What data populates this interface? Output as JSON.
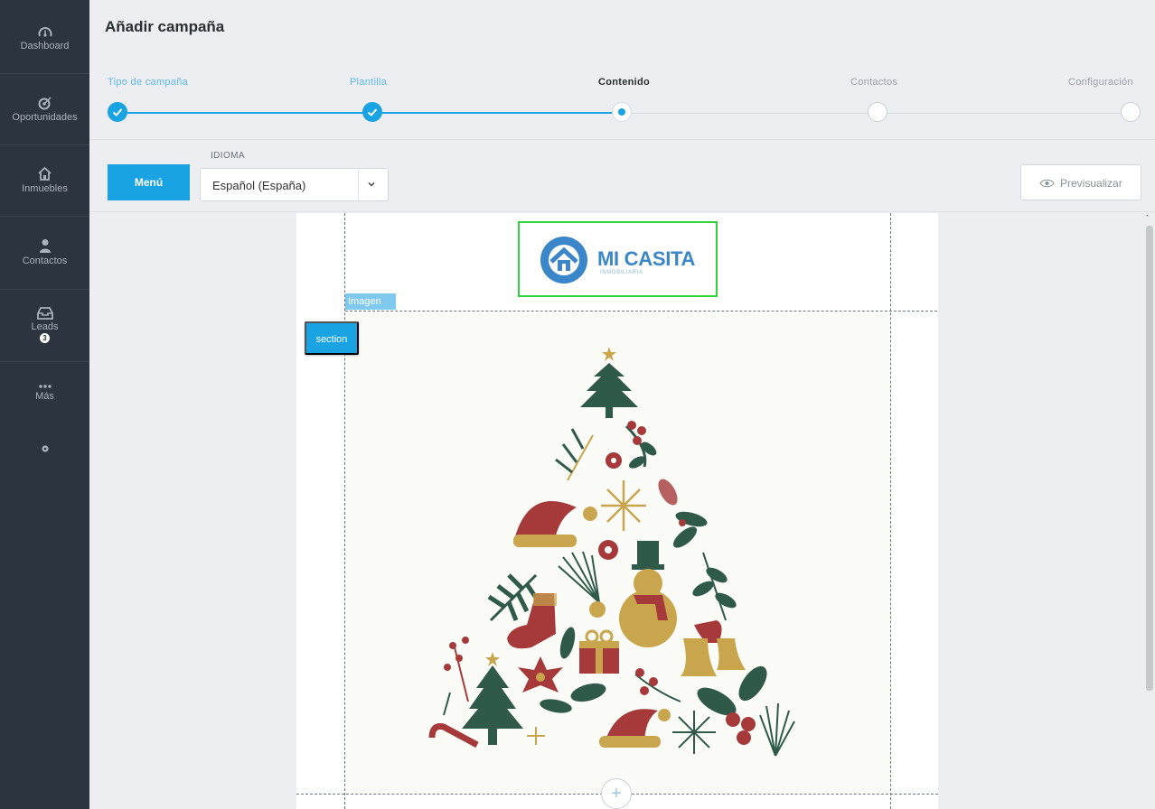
{
  "sidebar": {
    "items": [
      {
        "label": "Dashboard",
        "icon": "gauge-icon"
      },
      {
        "label": "Oportunidades",
        "icon": "target-icon"
      },
      {
        "label": "Inmuebles",
        "icon": "house-icon"
      },
      {
        "label": "Contactos",
        "icon": "person-icon"
      },
      {
        "label": "Leads",
        "icon": "inbox-icon",
        "badge": "3"
      },
      {
        "label": "Más",
        "icon": "more-dots-icon"
      }
    ],
    "settings_icon": "gear-icon"
  },
  "header": {
    "title": "Añadir campaña"
  },
  "stepper": {
    "steps": [
      {
        "label": "Tipo de campaña",
        "state": "done"
      },
      {
        "label": "Plantilla",
        "state": "done"
      },
      {
        "label": "Contenido",
        "state": "active"
      },
      {
        "label": "Contactos",
        "state": "todo"
      },
      {
        "label": "Configuración",
        "state": "todo"
      }
    ]
  },
  "toolbar": {
    "menu_label": "Menú",
    "language_caption": "IDIOMA",
    "language_value": "Español (España)",
    "preview_label": "Previsualizar"
  },
  "editor": {
    "logo": {
      "title": "MI CASITA",
      "subtitle": "INMOBILIARIA"
    },
    "image_tag": "Imagen",
    "section_label": "section",
    "add_block": "+"
  },
  "colors": {
    "accent": "#1aa3e3",
    "sidebar": "#2c353f",
    "selection": "#2fd43b",
    "xmas_green": "#2f5a4a",
    "xmas_red": "#a63a3a",
    "xmas_gold": "#c9a54e"
  }
}
